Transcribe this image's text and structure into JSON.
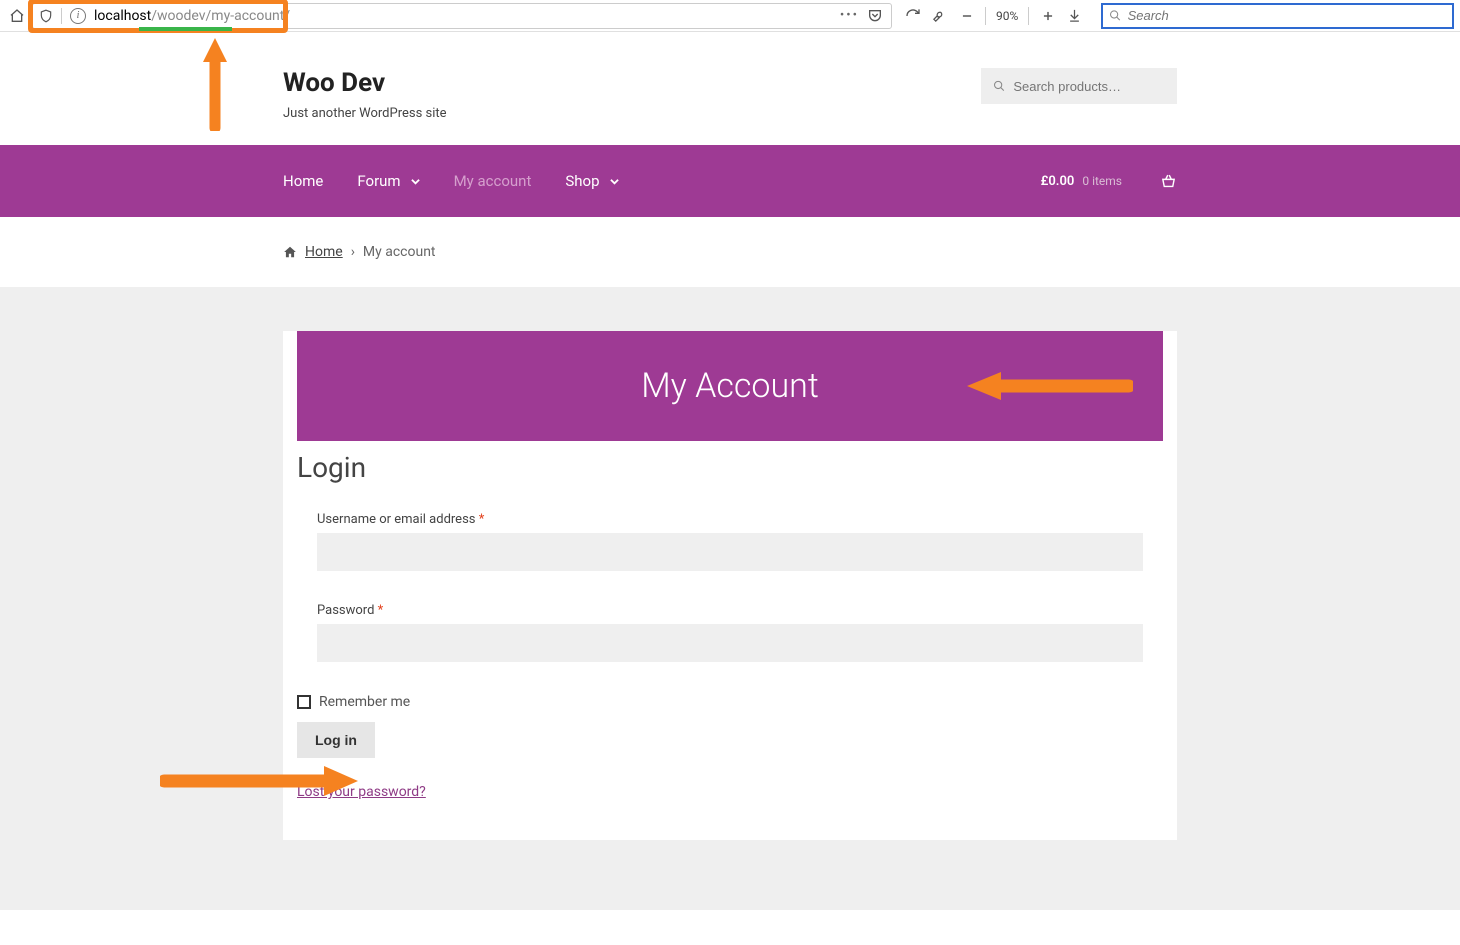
{
  "browser": {
    "url_host": "localhost",
    "url_path": "/woodev/my-account/",
    "zoom": "90%",
    "search_placeholder": "Search"
  },
  "site": {
    "title": "Woo Dev",
    "tagline": "Just another WordPress site",
    "search_placeholder": "Search products…"
  },
  "nav": {
    "items": [
      "Home",
      "Forum",
      "My account",
      "Shop"
    ],
    "cart_amount": "£0.00",
    "cart_items": "0 items"
  },
  "breadcrumb": {
    "home": "Home",
    "sep": "›",
    "current": "My account"
  },
  "page": {
    "banner_title": "My Account",
    "login_heading": "Login",
    "username_label": "Username or email address ",
    "password_label": "Password ",
    "required": "*",
    "remember_label": "Remember me",
    "login_btn": "Log in",
    "lost_password": "Lost your password?"
  },
  "colors": {
    "brand": "#9e3a94",
    "annotation": "#f58220"
  }
}
